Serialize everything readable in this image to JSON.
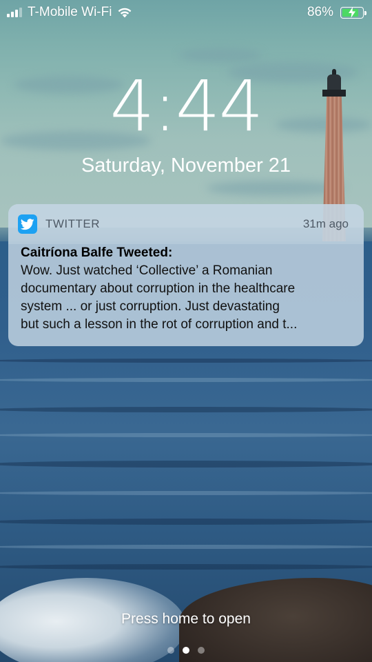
{
  "status_bar": {
    "carrier": "T-Mobile Wi-Fi",
    "battery_percent_label": "86%",
    "battery_level": 0.86,
    "signal_bars_active": 3,
    "signal_bars_total": 4,
    "battery_color": "#4cd964",
    "charging": true,
    "icons": [
      "signal-icon",
      "wifi-icon",
      "battery-icon",
      "charging-bolt-icon"
    ]
  },
  "lock_screen": {
    "time": "4:44",
    "date": "Saturday, November 21"
  },
  "notification": {
    "app_icon": "twitter-bird-icon",
    "app_icon_color": "#1da1f2",
    "app_name": "TWITTER",
    "time_ago": "31m ago",
    "title": "Caitríona Balfe Tweeted:",
    "lines": [
      "Wow. Just watched ‘Collective’ a Romanian",
      "documentary about corruption in the healthcare",
      "system ... or just corruption. Just devastating",
      "but such a lesson in the rot of corruption and t..."
    ]
  },
  "bottom": {
    "hint": "Press home to open",
    "page_count": 3,
    "active_page": 2
  }
}
